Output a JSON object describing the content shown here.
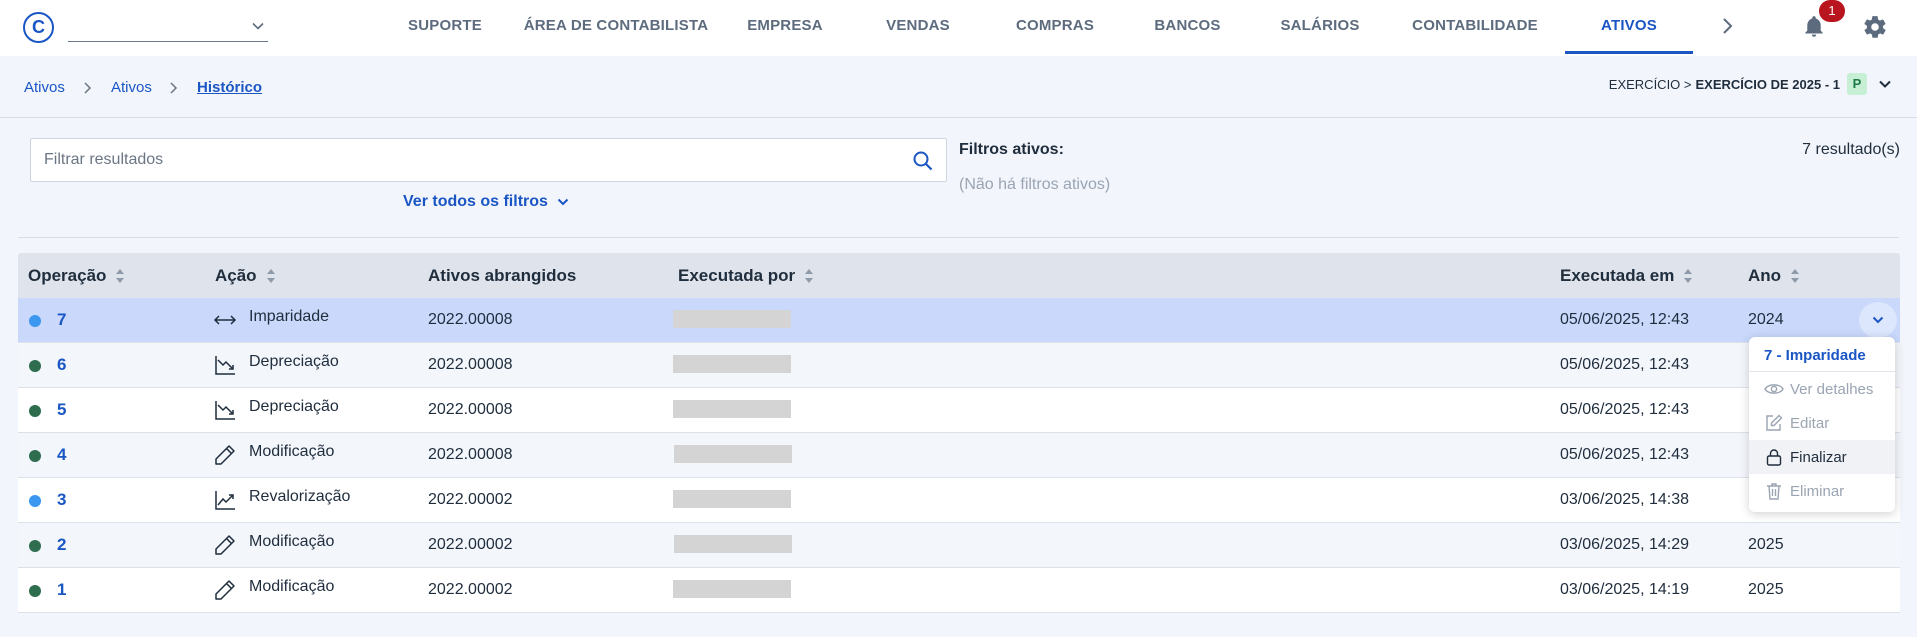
{
  "app": {
    "logo_letter": "C",
    "company_selector_value": ""
  },
  "nav": {
    "items": [
      "SUPORTE",
      "ÁREA DE CONTABILISTA",
      "EMPRESA",
      "VENDAS",
      "COMPRAS",
      "BANCOS",
      "SALÁRIOS",
      "CONTABILIDADE",
      "ATIVOS"
    ],
    "active": "ATIVOS",
    "notifications_count": "1"
  },
  "breadcrumb": [
    "Ativos",
    "Ativos",
    "Histórico"
  ],
  "exercise": {
    "label": "EXERCÍCIO >",
    "value": "EXERCÍCIO DE 2025 - 1",
    "badge": "P"
  },
  "filters": {
    "search_placeholder": "Filtrar resultados",
    "search_value": "",
    "see_all_label": "Ver todos os filtros",
    "active_title": "Filtros ativos:",
    "active_none": "(Não há filtros ativos)",
    "results_count": "7 resultado(s)"
  },
  "table": {
    "headers": {
      "operation": "Operação",
      "action": "Ação",
      "assets": "Ativos abrangidos",
      "executed_by": "Executada por",
      "executed_on": "Executada em",
      "year": "Ano"
    },
    "rows": [
      {
        "op": "7",
        "status_color": "#3b97f0",
        "action": "Imparidade",
        "action_icon": "arrows-horizontal-icon",
        "assets": "2022.00008",
        "executed_by": "",
        "date": "05/06/2025, 12:43",
        "year": "2024"
      },
      {
        "op": "6",
        "status_color": "#2e6e4e",
        "action": "Depreciação",
        "action_icon": "chart-down-icon",
        "assets": "2022.00008",
        "executed_by": "",
        "date": "05/06/2025, 12:43",
        "year": ""
      },
      {
        "op": "5",
        "status_color": "#2e6e4e",
        "action": "Depreciação",
        "action_icon": "chart-down-icon",
        "assets": "2022.00008",
        "executed_by": "",
        "date": "05/06/2025, 12:43",
        "year": ""
      },
      {
        "op": "4",
        "status_color": "#2e6e4e",
        "action": "Modificação",
        "action_icon": "pencil-icon",
        "assets": "2022.00008",
        "executed_by": "",
        "date": "05/06/2025, 12:43",
        "year": ""
      },
      {
        "op": "3",
        "status_color": "#3b97f0",
        "action": "Revalorização",
        "action_icon": "chart-up-icon",
        "assets": "2022.00002",
        "executed_by": "",
        "date": "03/06/2025, 14:38",
        "year": ""
      },
      {
        "op": "2",
        "status_color": "#2e6e4e",
        "action": "Modificação",
        "action_icon": "pencil-icon",
        "assets": "2022.00002",
        "executed_by": "",
        "date": "03/06/2025, 14:29",
        "year": "2025"
      },
      {
        "op": "1",
        "status_color": "#2e6e4e",
        "action": "Modificação",
        "action_icon": "pencil-icon",
        "assets": "2022.00002",
        "executed_by": "",
        "date": "03/06/2025, 14:19",
        "year": "2025"
      }
    ]
  },
  "row_menu": {
    "title": "7 - Imparidade",
    "items": [
      {
        "label": "Ver detalhes",
        "icon": "eye-icon",
        "enabled": false
      },
      {
        "label": "Editar",
        "icon": "edit-icon",
        "enabled": false
      },
      {
        "label": "Finalizar",
        "icon": "lock-icon",
        "enabled": true
      },
      {
        "label": "Eliminar",
        "icon": "trash-icon",
        "enabled": false
      }
    ]
  },
  "colors": {
    "accent": "#1a56c4",
    "selected_row": "#c9d8fb",
    "notification_badge": "#b8151f"
  }
}
